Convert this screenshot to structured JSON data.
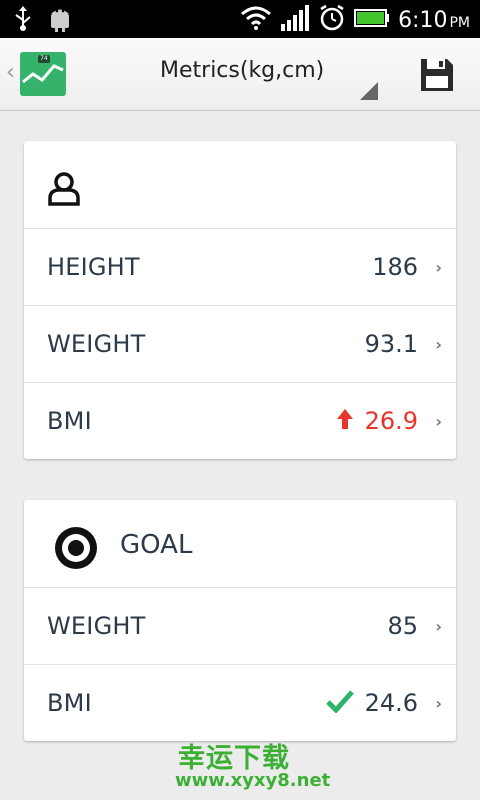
{
  "status_bar": {
    "time": "6:10",
    "ampm": "PM",
    "icons": [
      "usb-icon",
      "android-debug-icon",
      "wifi-icon",
      "signal-icon",
      "alarm-icon",
      "battery-icon"
    ]
  },
  "app_bar": {
    "back_glyph": "‹",
    "title": "Metrics(kg,cm)",
    "app_icon_text": "74",
    "save_icon": "save-icon"
  },
  "profile_card": {
    "icon": "person-icon",
    "rows": [
      {
        "label": "HEIGHT",
        "value": "186"
      },
      {
        "label": "WEIGHT",
        "value": "93.1"
      },
      {
        "label": "BMI",
        "value": "26.9",
        "indicator": "up-arrow",
        "color": "#e8352c"
      }
    ]
  },
  "goal_card": {
    "icon": "target-icon",
    "title": "GOAL",
    "rows": [
      {
        "label": "WEIGHT",
        "value": "85"
      },
      {
        "label": "BMI",
        "value": "24.6",
        "indicator": "check",
        "color": "#2eb36b"
      }
    ]
  },
  "watermark": {
    "line1": "幸运下载",
    "line2": "www.xyxy8.net"
  },
  "colors": {
    "accent_green": "#36b36a",
    "text_dark": "#2d3a49",
    "warning_red": "#e8352c"
  }
}
